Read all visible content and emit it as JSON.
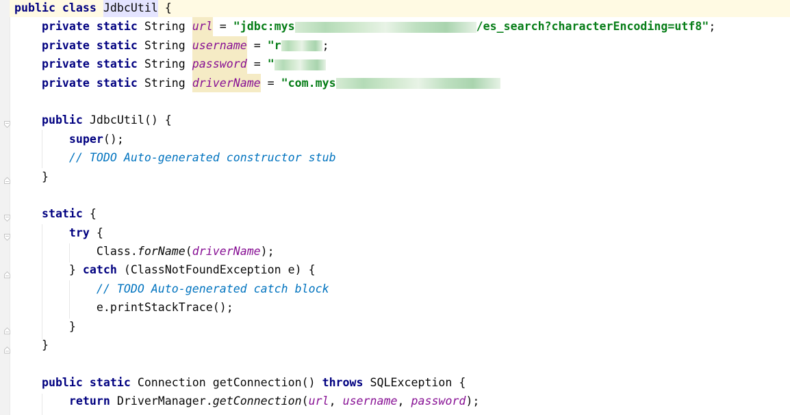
{
  "editor": {
    "language": "java",
    "current_line": 1,
    "lines": [
      [
        [
          "public class ",
          "kw"
        ],
        [
          "JdbcUtil",
          "cls"
        ],
        [
          " {",
          ""
        ]
      ],
      [
        [
          "    private static ",
          "kw"
        ],
        [
          "String ",
          ""
        ],
        [
          "url",
          "fldhl"
        ],
        [
          " = ",
          ""
        ],
        [
          "\"jdbc:mys",
          "str"
        ],
        [
          "",
          "red"
        ],
        [
          "/es_search?characterEncoding=utf8\"",
          "str"
        ],
        [
          ";",
          ""
        ]
      ],
      [
        [
          "    private static ",
          "kw"
        ],
        [
          "String ",
          ""
        ],
        [
          "username",
          "fldhl"
        ],
        [
          " = ",
          ""
        ],
        [
          "\"r",
          "str"
        ],
        [
          "",
          "red"
        ],
        [
          ";",
          ""
        ]
      ],
      [
        [
          "    private static ",
          "kw"
        ],
        [
          "String ",
          ""
        ],
        [
          "password",
          "fldhl"
        ],
        [
          " = ",
          ""
        ],
        [
          "\"",
          "str"
        ],
        [
          "",
          "red"
        ]
      ],
      [
        [
          "    private static ",
          "kw"
        ],
        [
          "String ",
          ""
        ],
        [
          "driverName",
          "fldhl"
        ],
        [
          " = ",
          ""
        ],
        [
          "\"com.mys",
          "str"
        ],
        [
          "",
          "red"
        ]
      ],
      [],
      [
        [
          "    public ",
          "kw"
        ],
        [
          "JdbcUtil() {",
          ""
        ]
      ],
      [
        [
          "        super",
          "kw"
        ],
        [
          "();",
          ""
        ]
      ],
      [
        [
          "        // ",
          "cmt"
        ],
        [
          "TODO Auto-generated constructor stub",
          "cmt"
        ]
      ],
      [
        [
          "    }",
          ""
        ]
      ],
      [],
      [
        [
          "    static ",
          "kw"
        ],
        [
          "{",
          ""
        ]
      ],
      [
        [
          "        try ",
          "kw"
        ],
        [
          "{",
          ""
        ]
      ],
      [
        [
          "            Class.",
          ""
        ],
        [
          "forName",
          "mth"
        ],
        [
          "(",
          ""
        ],
        [
          "driverName",
          "fld"
        ],
        [
          ");",
          ""
        ]
      ],
      [
        [
          "        } ",
          ""
        ],
        [
          "catch ",
          "kw"
        ],
        [
          "(ClassNotFoundException e) {",
          ""
        ]
      ],
      [
        [
          "            // ",
          "cmt"
        ],
        [
          "TODO Auto-generated catch block",
          "cmt"
        ]
      ],
      [
        [
          "            e.printStackTrace();",
          ""
        ]
      ],
      [
        [
          "        }",
          ""
        ]
      ],
      [
        [
          "    }",
          ""
        ]
      ],
      [],
      [
        [
          "    public static ",
          "kw"
        ],
        [
          "Connection getConnection() ",
          ""
        ],
        [
          "throws ",
          "kw"
        ],
        [
          "SQLException {",
          ""
        ]
      ],
      [
        [
          "        return ",
          "kw"
        ],
        [
          "DriverManager.",
          ""
        ],
        [
          "getConnection",
          "mth"
        ],
        [
          "(",
          ""
        ],
        [
          "url",
          "fld"
        ],
        [
          ", ",
          ""
        ],
        [
          "username",
          "fld"
        ],
        [
          ", ",
          ""
        ],
        [
          "password",
          "fld"
        ],
        [
          ");",
          ""
        ]
      ]
    ]
  },
  "colors": {
    "keyword": "#000080",
    "string": "#067d17",
    "field": "#871094",
    "comment": "#0073bf",
    "current_line": "#fffae3"
  }
}
